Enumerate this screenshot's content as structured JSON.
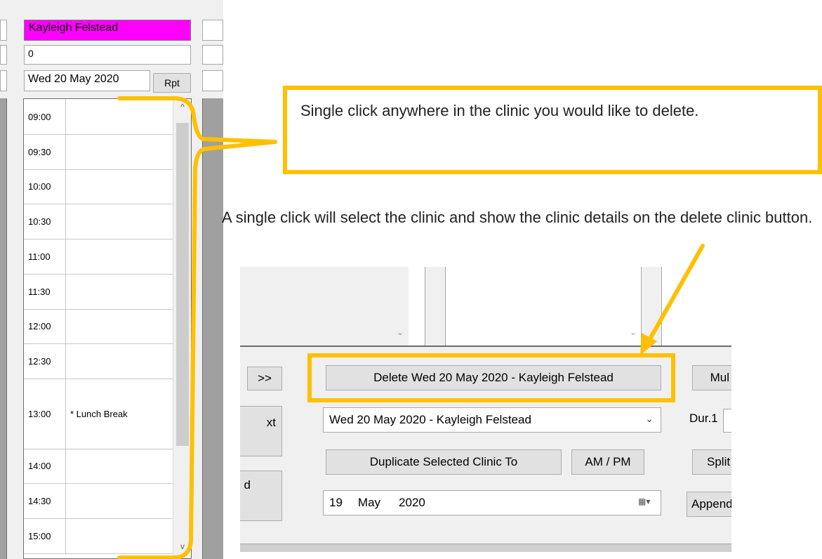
{
  "scheduler": {
    "clinician_name": "Kayleigh Felstead",
    "count_value": "0",
    "date_value": "Wed 20 May 2020",
    "rpt_label": "Rpt",
    "slots": [
      {
        "time": "09:00",
        "desc": ""
      },
      {
        "time": "09:30",
        "desc": ""
      },
      {
        "time": "10:00",
        "desc": ""
      },
      {
        "time": "10:30",
        "desc": ""
      },
      {
        "time": "11:00",
        "desc": ""
      },
      {
        "time": "11:30",
        "desc": ""
      },
      {
        "time": "12:00",
        "desc": ""
      },
      {
        "time": "12:30",
        "desc": ""
      },
      {
        "time": "13:00",
        "desc": "* Lunch Break"
      },
      {
        "time": "14:00",
        "desc": ""
      },
      {
        "time": "14:30",
        "desc": ""
      },
      {
        "time": "15:00",
        "desc": ""
      }
    ],
    "scroll_up_glyph": "^",
    "scroll_down_glyph": "v"
  },
  "callout": {
    "text": "Single click anywhere in the clinic you would like to delete."
  },
  "info_text": "A single click will select the clinic and show the clinic details on the delete clinic button.",
  "form": {
    "next_label": ">>",
    "delete_button_label": "Delete Wed 20 May 2020 - Kayleigh Felstead",
    "multi_label": "Mul",
    "clinic_select_value": "Wed 20 May 2020 - Kayleigh Felstead",
    "dur_label": "Dur.1",
    "side_button_a": "xt",
    "side_button_b": "d",
    "duplicate_label": "Duplicate Selected Clinic To",
    "ampm_label": "AM / PM",
    "split_label": "Split",
    "date_day": "19",
    "date_month": "May",
    "date_year": "2020",
    "append_label": "Append"
  },
  "colors": {
    "highlight": "#ffc000",
    "name_bg": "#ff00ff"
  }
}
